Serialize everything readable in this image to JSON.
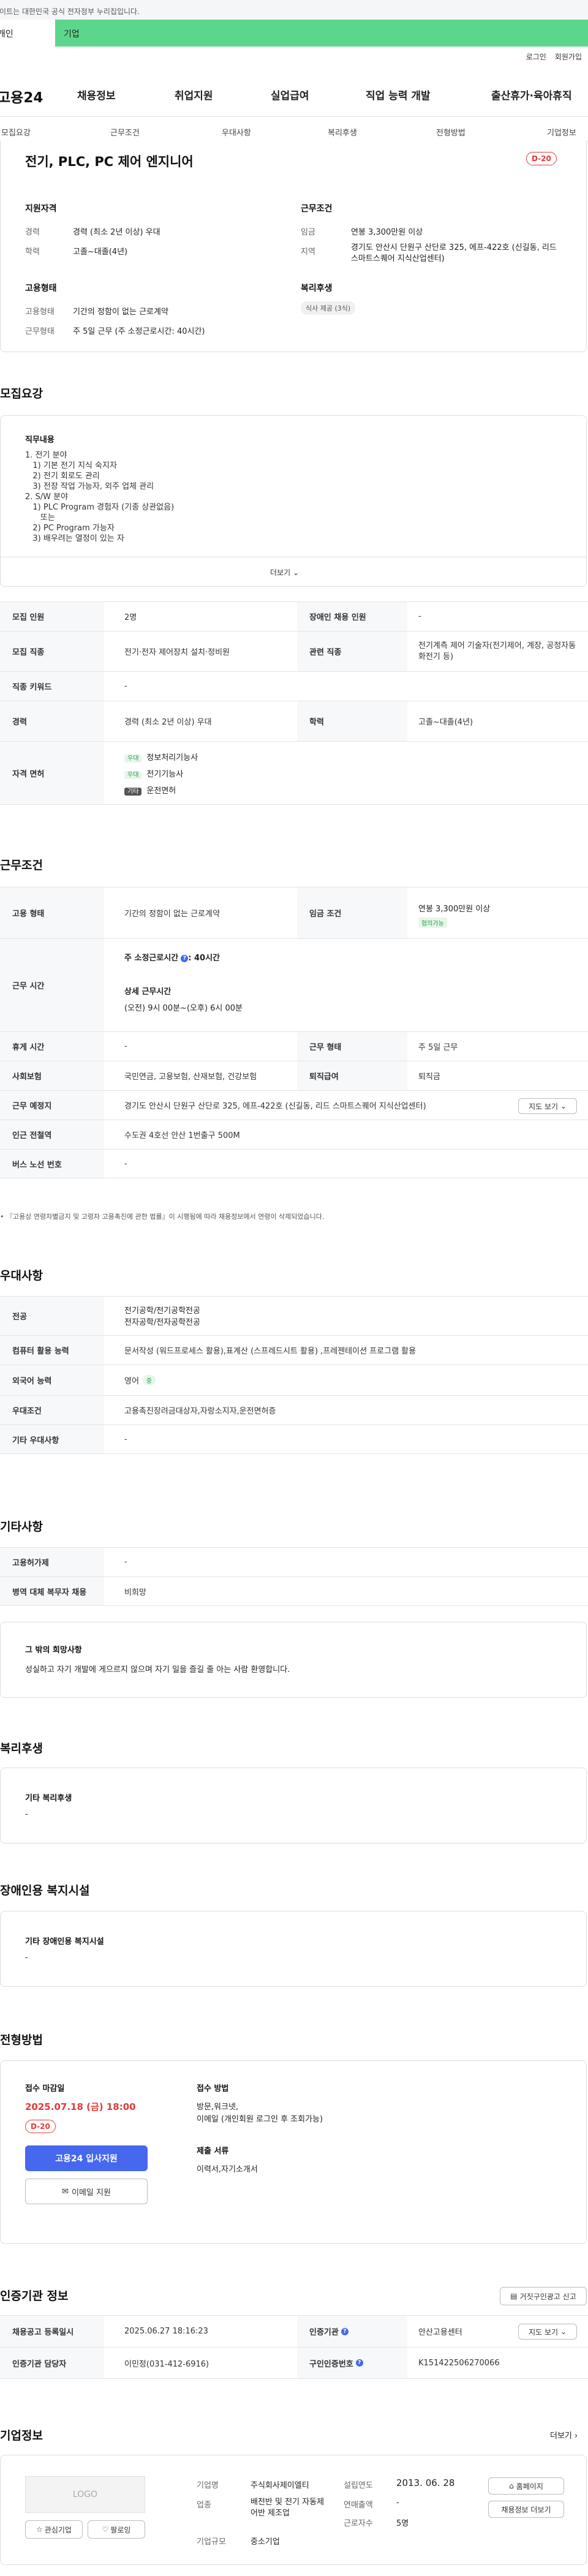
{
  "topbar": {
    "notice": "사이트는 대한민국 공식 전자정부 누리집입니다."
  },
  "tabs": {
    "person": "개인",
    "corp": "기업"
  },
  "util": {
    "login": "로그인",
    "join": "회원가입"
  },
  "gnb": {
    "logo": "고용24",
    "items": [
      "채용정보",
      "취업지원",
      "실업급여",
      "직업 능력 개발",
      "출산휴가·육아휴직"
    ]
  },
  "subnav": [
    "모집요강",
    "근무조건",
    "우대사항",
    "복리후생",
    "전형방법",
    "기업정보"
  ],
  "job": {
    "title": "전기, PLC, PC 제어 엔지니어",
    "dday": "D-20",
    "qual_title": "지원자격",
    "career_label": "경력",
    "career_value": "경력 (최소 2년 이상) 우대",
    "edu_label": "학력",
    "edu_value": "고졸~대졸(4년)",
    "employ_title": "고용형태",
    "employ_label": "고용형태",
    "employ_value": "기간의 정함이 없는 근로계약",
    "worktype_label": "근무형태",
    "worktype_value": "주 5일 근무 (주 소정근로시간: 40시간)",
    "cond_title": "근무조건",
    "wage_label": "임금",
    "wage_value": "연봉 3,300만원 이상",
    "region_label": "지역",
    "region_value": "경기도 안산시 단원구 산단로 325, 에프-422호 (신길동, 리드 스마트스퀘어 지식산업센터)",
    "welfare_title": "복리후생",
    "welfare_pill": "식사 제공 (3식)"
  },
  "recruit": {
    "heading": "모집요강",
    "duty_title": "직무내용",
    "duty_lines": [
      "1. 전기 분야",
      "   1) 기본 전기 지식 숙지자",
      "   2) 전기 회로도 관리",
      "   3) 전장 작업 가능자, 외주 업체 관리",
      "2. S/W 분야",
      "   1) PLC Program 경험자 (기종 상관없음)",
      "      또는",
      "   2) PC Program 가능자",
      "   3) 배우려는 열정이 있는 자"
    ],
    "more": "더보기",
    "rows": {
      "count_label": "모집 인원",
      "count_value": "2명",
      "disabled_label": "장애인 채용 인원",
      "disabled_value": "-",
      "job_label": "모집 직종",
      "job_value": "전기·전자 제어장치 설치·정비원",
      "related_label": "관련 직종",
      "related_value": "전기계측 제어 기술자(전기제어, 계장, 공정자동화전기 등)",
      "keyword_label": "직종 키워드",
      "keyword_value": "-",
      "career_label": "경력",
      "career_value": "경력 (최소 2년 이상) 우대",
      "edu_label": "학력",
      "edu_value": "고졸~대졸(4년)",
      "license_label": "자격 면허",
      "licenses": [
        {
          "chip": "우대",
          "name": "정보처리기능사"
        },
        {
          "chip": "우대",
          "name": "전기기능사"
        },
        {
          "chip": "기타",
          "name": "운전면허"
        }
      ]
    }
  },
  "work": {
    "heading": "근무조건",
    "type_label": "고용 형태",
    "type_value": "기간의 정함이 없는 근로계약",
    "wage_label": "임금 조건",
    "wage_value": "연봉 3,300만원 이상",
    "wage_tag": "협의가능",
    "time_label": "근무 시간",
    "time_week": "주 소정근로시간",
    "time_week_value": ": 40시간",
    "time_detail_title": "상세 근무시간",
    "time_detail_value": "(오전) 9시 00분~(오후) 6시 00분",
    "rest_label": "휴게 시간",
    "rest_value": "-",
    "form_label": "근무 형태",
    "form_value": "주 5일 근무",
    "insurance_label": "사회보험",
    "insurance_value": "국민연금, 고용보험, 산재보험, 건강보험",
    "retire_label": "퇴직급여",
    "retire_value": "퇴직금",
    "place_label": "근무 예정지",
    "place_value": "경기도 안산시 단원구 산단로 325, 에프-422호 (신길동, 리드 스마트스퀘어 지식산업센터)",
    "map_btn": "지도 보기",
    "subway_label": "인근 전철역",
    "subway_value": "수도권 4호선 안산 1번출구 500M",
    "bus_label": "버스 노선 번호",
    "bus_value": "-",
    "note": "『고용상 연령차별금지 및 고령자 고용촉진에 관한 법률』이 시행됨에 따라 채용정보에서 연령이 삭제되었습니다."
  },
  "prefer": {
    "heading": "우대사항",
    "major_label": "전공",
    "major_values": [
      "전기공학/전기공학전공",
      "전자공학/전자공학전공"
    ],
    "pc_label": "컴퓨터 활용 능력",
    "pc_value": "문서작성 (워드프로세스 활용),표계산 (스프레드시트 활용) ,프레젠테이션 프로그램 활용",
    "lang_label": "외국어 능력",
    "lang_value": "영어",
    "lang_tag": "중",
    "cond_label": "우대조건",
    "cond_value": "고용촉진장려금대상자,자랑소지자,운전면허증",
    "etc_label": "기타 우대사항",
    "etc_value": "-"
  },
  "other": {
    "heading": "기타사항",
    "facility_label": "고용허가제",
    "facility_value": "-",
    "military_label": "병역 대체 복무자 채용",
    "military_value": "비희망",
    "wish_title": "그 밖의 희망사항",
    "wish_value": "성실하고 자기 개발에 게으르지 않으며 자기 일을 즐길 줄 아는 사람 환영합니다."
  },
  "welfare": {
    "heading": "복리후생",
    "etc_title": "기타 복리후생",
    "etc_value": "-"
  },
  "disability": {
    "heading": "장애인용 복지시설",
    "etc_title": "기타 장애인용 복지시설",
    "etc_value": "-"
  },
  "process": {
    "heading": "전형방법",
    "deadline_title": "접수 마감일",
    "deadline_value": "2025.07.18 (금) 18:00",
    "dday": "D-20",
    "apply_btn": "고용24 입사지원",
    "email_btn": "이메일 지원",
    "method_title": "접수 방법",
    "method_lines": [
      "방문,워크넷,",
      "이메일 (개인회원 로그인 후 조회가능)"
    ],
    "doc_title": "제출 서류",
    "doc_value": "이력서,자기소개서"
  },
  "agency": {
    "heading": "인증기관 정보",
    "report_btn": "거짓구인광고 신고",
    "reg_label": "채용공고 등록일시",
    "reg_value": "2025.06.27 18:16:23",
    "org_label": "인증기관",
    "org_value": "안산고용센터",
    "map_btn": "지도 보기",
    "manager_label": "인증기관 담당자",
    "manager_value": "이민정(031-412-6916)",
    "id_label": "구인인증번호",
    "id_value": "K151422506270066"
  },
  "company": {
    "heading": "기업정보",
    "more": "더보기",
    "logo": "LOGO",
    "fav_btn": "관심기업",
    "follow_btn": "팔로잉",
    "name_label": "기업명",
    "name_value": "주식회사제이엘티",
    "found_label": "설립연도",
    "found_value": "2013. 06. 28",
    "industry_label": "업종",
    "industry_value": "배전반 및 전기 자동제어반 제조업",
    "revenue_label": "연매출액",
    "revenue_value": "-",
    "size_label": "기업규모",
    "size_value": "중소기업",
    "employees_label": "근로자수",
    "employees_value": "5명",
    "home_btn": "홈페이지",
    "jobs_btn": "채용정보 더보기"
  }
}
